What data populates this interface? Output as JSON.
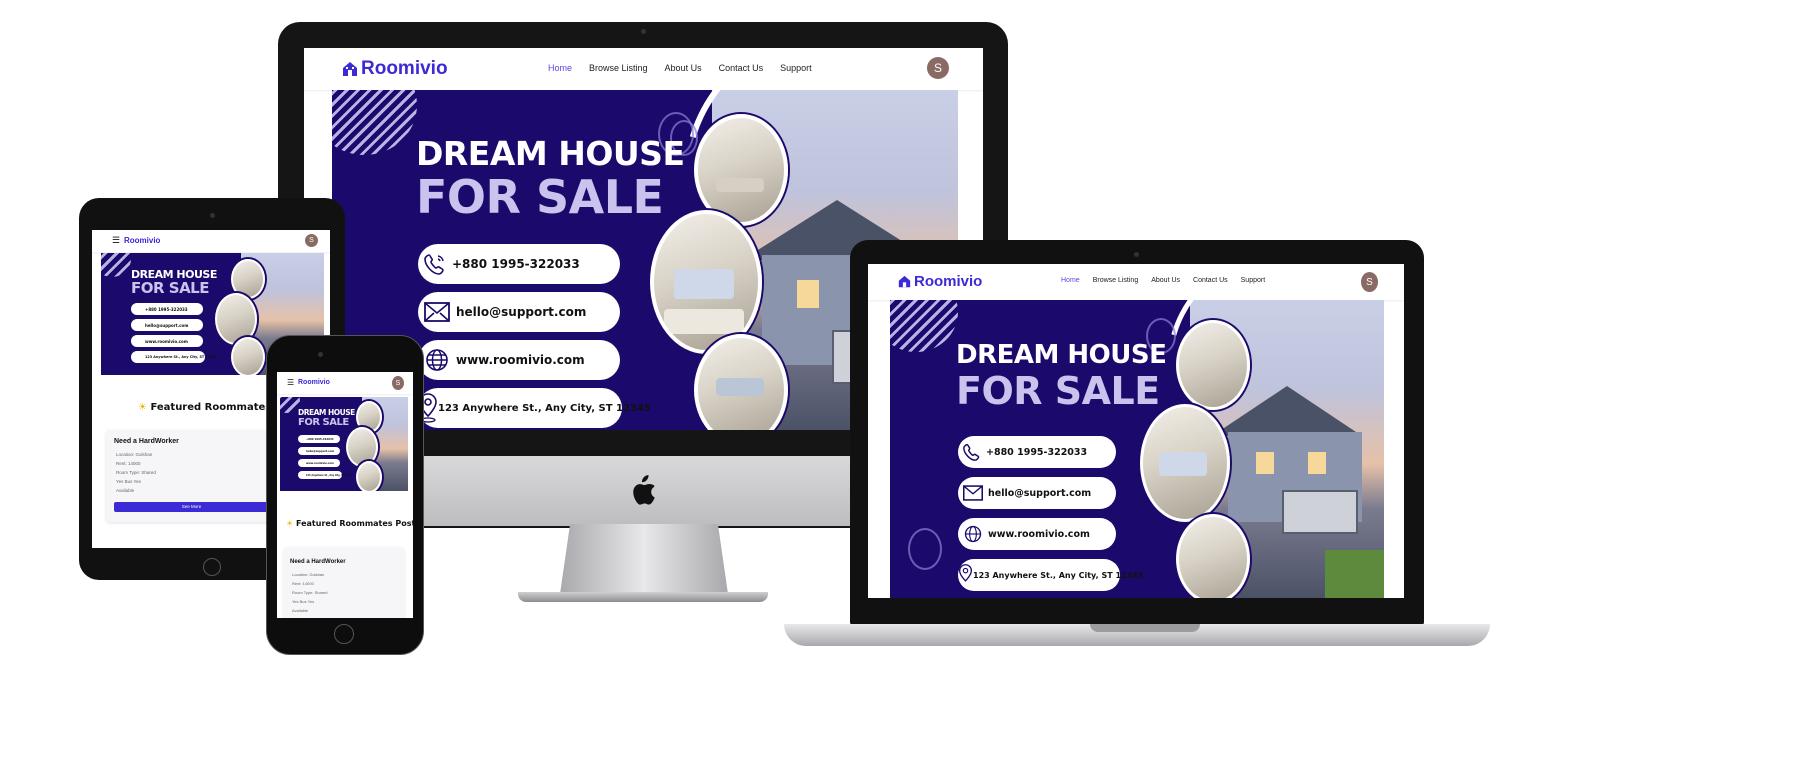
{
  "site": {
    "brand": "Roomivio",
    "nav": [
      "Home",
      "Browse Listing",
      "About Us",
      "Contact Us",
      "Support"
    ],
    "avatar_initial": "S",
    "menu_icon": "hamburger-icon",
    "logo_icon": "house-icon"
  },
  "banner": {
    "title_line1": "DREAM HOUSE",
    "title_line2": "FOR SALE",
    "contacts": [
      {
        "icon": "phone-icon",
        "text": "+880 1995-322033"
      },
      {
        "icon": "mail-icon",
        "text": "hello@support.com"
      },
      {
        "icon": "globe-icon",
        "text": "www.roomivio.com"
      },
      {
        "icon": "location-pin-icon",
        "text": "123 Anywhere St., Any City, ST 12345"
      }
    ]
  },
  "tablet_banner": {
    "contacts": [
      "+880 1995-322033",
      "hello@support.com",
      "www.roomivio.com",
      "123 Anywhere St., Any City, ST 12345"
    ]
  },
  "featured": {
    "icon": "sun-icon",
    "tablet_heading": "Featured Roommates P",
    "phone_heading": "Featured Roommates Posts",
    "card_title": "Need a HardWorker",
    "tablet_rows": [
      "Location: Gulshan",
      "Rent: 14000",
      "Room Type: Shared",
      "Yes Bus Yes",
      "Available"
    ],
    "phone_rows": [
      "Location: Gulshan",
      "Rent: 14000",
      "Room Type: Shared",
      "Yes Bus Yes",
      "Available"
    ],
    "see_more": "See More"
  },
  "colors": {
    "brand": "#3b2ad6",
    "banner_bg": "#1b0a6b",
    "avatar": "#8a6a64"
  }
}
